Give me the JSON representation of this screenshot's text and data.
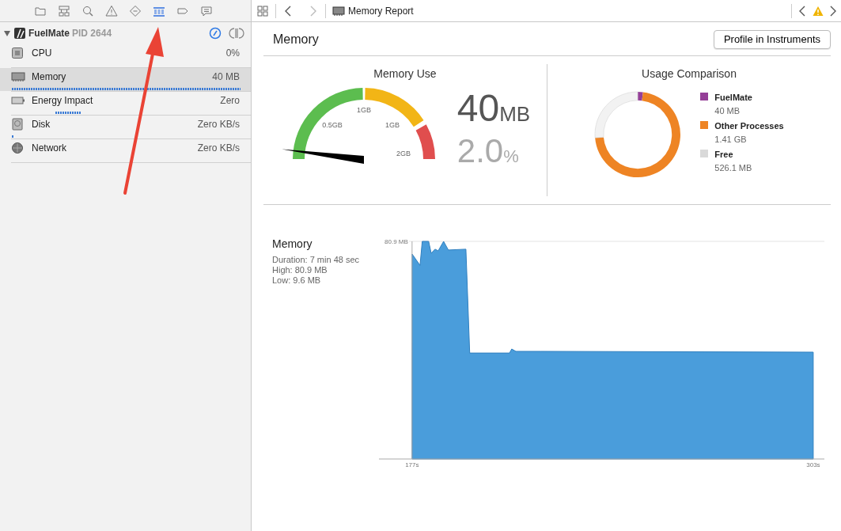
{
  "navigator_tabs": [
    {
      "kind": "folder",
      "selected": false
    },
    {
      "kind": "hierarchy",
      "selected": false
    },
    {
      "kind": "search",
      "selected": false
    },
    {
      "kind": "warning",
      "selected": false
    },
    {
      "kind": "diamond",
      "selected": false
    },
    {
      "kind": "list",
      "selected": true
    },
    {
      "kind": "tag",
      "selected": false
    },
    {
      "kind": "comment",
      "selected": false
    }
  ],
  "process": {
    "name": "FuelMate",
    "pid": "PID 2644",
    "expanded": true
  },
  "gauges": [
    {
      "kind": "cpu",
      "name": "CPU",
      "value": "0%",
      "selected": false
    },
    {
      "kind": "memory",
      "name": "Memory",
      "value": "40 MB",
      "selected": true
    },
    {
      "kind": "energy",
      "name": "Energy Impact",
      "value": "Zero",
      "selected": false
    },
    {
      "kind": "disk",
      "name": "Disk",
      "value": "Zero KB/s",
      "selected": false
    },
    {
      "kind": "network",
      "name": "Network",
      "value": "Zero KB/s",
      "selected": false
    }
  ],
  "jump_bar": {
    "title": "Memory Report",
    "forward_disabled": true
  },
  "report": {
    "title": "Memory",
    "button": "Profile in Instruments",
    "memory_use": {
      "title": "Memory Use",
      "scale_labels": [
        "0.5GB",
        "1GB",
        "1GB",
        "2GB"
      ],
      "amount": "40",
      "amount_unit": "MB",
      "percent": "2.0",
      "percent_unit": "%"
    },
    "usage_comparison": {
      "title": "Usage Comparison",
      "legend": [
        {
          "value": "40 MB",
          "color": "#953f98"
        },
        {
          "value": "1.41 GB",
          "color": "#ee8424"
        },
        {
          "value": "526.1 MB",
          "color": "#d9d9d9"
        }
      ],
      "chart_data": {
        "type": "donut",
        "categories": [
          "FuelMate",
          "Other Processes",
          "Free"
        ],
        "values": [
          2.0,
          71.8,
          26.2
        ]
      }
    },
    "history": {
      "stats": [
        "Duration: 7 min 48 sec",
        "High: 80.9 MB",
        "Low: 9.6 MB"
      ],
      "chart_data": {
        "type": "area",
        "x": [
          177,
          179.5,
          180.2,
          182.2,
          183,
          184.2,
          185.2,
          186.9,
          188.4,
          193.9,
          195.1,
          207.6,
          208.3,
          209.6,
          217.5,
          303
        ],
        "series": [
          {
            "name": "Memory",
            "color": "#4a9ddb",
            "values": [
              76.2,
              72,
              80.9,
              80.9,
              76.5,
              78,
              77.4,
              80.9,
              77.7,
              78,
              39.4,
              39.4,
              40.9,
              40,
              40,
              39.7
            ]
          }
        ],
        "xlim": [
          166.6,
          306.5
        ],
        "ylim": [
          0,
          80.9
        ],
        "xticks": [
          {
            "value": 177,
            "label": "177s"
          },
          {
            "value": 303,
            "label": "303s"
          }
        ],
        "yticks": [
          {
            "value": 80.9,
            "label": "80.9 MB"
          }
        ]
      }
    }
  },
  "annotations": [
    {
      "kind": "arrow"
    }
  ]
}
